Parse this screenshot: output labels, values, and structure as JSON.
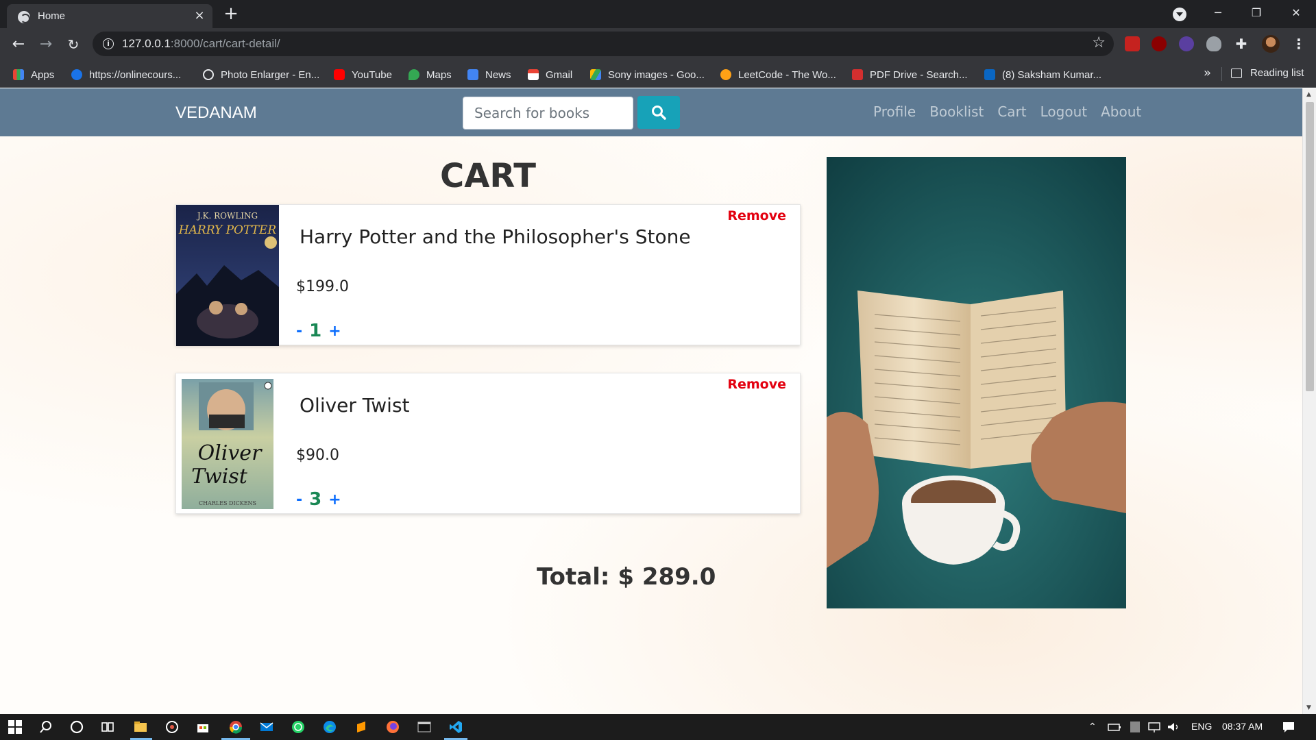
{
  "browser": {
    "tab_title": "Home",
    "tab_close": "×",
    "new_tab": "+",
    "window_controls": {
      "minimize": "─",
      "restore": "❐",
      "close": "✕"
    },
    "url_host": "127.0.0.1",
    "url_path": ":8000/cart/cart-detail/",
    "info": "i",
    "star": "☆",
    "kebab": "⋮"
  },
  "bookmarks": {
    "items": [
      {
        "label": "Apps",
        "icon_color": "#ea4335"
      },
      {
        "label": "https://onlinecours...",
        "icon_color": "#1a73e8"
      },
      {
        "label": "Photo Enlarger - En...",
        "icon_color": "#e8eaed"
      },
      {
        "label": "YouTube",
        "icon_color": "#ff0000"
      },
      {
        "label": "Maps",
        "icon_color": "#34a853"
      },
      {
        "label": "News",
        "icon_color": "#4285f4"
      },
      {
        "label": "Gmail",
        "icon_color": "#ea4335"
      },
      {
        "label": "Sony images - Goo...",
        "icon_color": "#fbbc04"
      },
      {
        "label": "LeetCode - The Wo...",
        "icon_color": "#ffa116"
      },
      {
        "label": "PDF Drive - Search...",
        "icon_color": "#d32f2f"
      },
      {
        "label": "(8) Saksham Kumar...",
        "icon_color": "#0a66c2"
      }
    ],
    "overflow": "»",
    "reading_list": "Reading list"
  },
  "site": {
    "brand": "VEDANAM",
    "search_placeholder": "Search for books",
    "nav": [
      "Profile",
      "Booklist",
      "Cart",
      "Logout",
      "About"
    ],
    "page_title": "CART",
    "cart_items": [
      {
        "title": "Harry Potter and the Philosopher's Stone",
        "price": "$199.0",
        "quantity": "1",
        "remove_label": "Remove",
        "cover_author": "J.K. ROWLING",
        "cover_title": "HARRY POTTER"
      },
      {
        "title": "Oliver Twist",
        "price": "$90.0",
        "quantity": "3",
        "remove_label": "Remove",
        "cover_title_1": "Oliver",
        "cover_title_2": "Twist",
        "cover_author": "CHARLES DICKENS"
      }
    ],
    "qty_decrement": "-",
    "qty_increment": "+",
    "total_label": "Total: $ 289.0"
  },
  "taskbar": {
    "language": "ENG",
    "time": "08:37 AM"
  },
  "colors": {
    "navbar": "#5e7a93",
    "search_button": "#17a2b8",
    "remove": "#e3000f",
    "qty_value": "#198754",
    "qty_controls": "#0d6efd"
  }
}
